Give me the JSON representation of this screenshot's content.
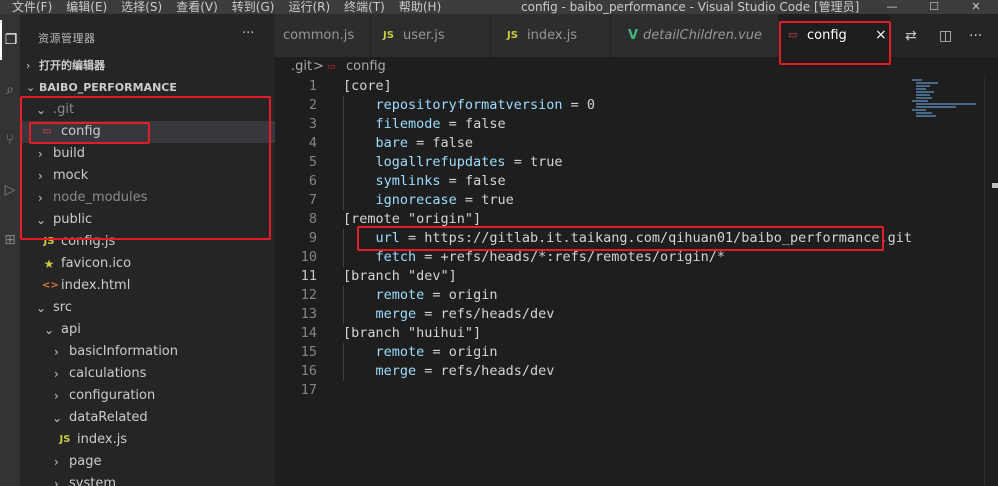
{
  "titlebar": {
    "menu": [
      "文件(F)",
      "编辑(E)",
      "选择(S)",
      "查看(V)",
      "转到(G)",
      "运行(R)",
      "终端(T)",
      "帮助(H)"
    ],
    "window_title": "config - baibo_performance - Visual Studio Code [管理员]"
  },
  "sidebar": {
    "title": "资源管理器",
    "more": "···",
    "open_editors_label": "打开的编辑器",
    "project_label": "BAIBO_PERFORMANCE",
    "tree": [
      {
        "label": ".git",
        "kind": "folder",
        "expanded": true,
        "dim": true
      },
      {
        "label": "config",
        "kind": "file",
        "icon": "config-file-icon",
        "selected": true
      },
      {
        "label": "build",
        "kind": "folder",
        "expanded": false
      },
      {
        "label": "mock",
        "kind": "folder",
        "expanded": false
      },
      {
        "label": "node_modules",
        "kind": "folder",
        "expanded": false,
        "dim": true
      },
      {
        "label": "public",
        "kind": "folder",
        "expanded": true
      },
      {
        "label": "config.js",
        "kind": "file",
        "icon": "js-file-icon"
      },
      {
        "label": "favicon.ico",
        "kind": "file",
        "icon": "star-icon"
      },
      {
        "label": "index.html",
        "kind": "file",
        "icon": "html-file-icon"
      },
      {
        "label": "src",
        "kind": "folder",
        "expanded": true
      },
      {
        "label": "api",
        "kind": "folder",
        "expanded": true
      },
      {
        "label": "basicInformation",
        "kind": "folder",
        "expanded": false
      },
      {
        "label": "calculations",
        "kind": "folder",
        "expanded": false
      },
      {
        "label": "configuration",
        "kind": "folder",
        "expanded": false
      },
      {
        "label": "dataRelated",
        "kind": "folder",
        "expanded": true
      },
      {
        "label": "index.js",
        "kind": "file",
        "icon": "js-file-icon"
      },
      {
        "label": "page",
        "kind": "folder",
        "expanded": false
      },
      {
        "label": "system",
        "kind": "folder",
        "expanded": false
      }
    ]
  },
  "tabs": [
    {
      "label": "common.js",
      "icon": ""
    },
    {
      "label": "user.js",
      "icon": "JS"
    },
    {
      "label": "index.js",
      "icon": "JS"
    },
    {
      "label": "detailChildren.vue",
      "icon": "V"
    },
    {
      "label": "config",
      "icon": "config",
      "active": true,
      "close": "×"
    }
  ],
  "breadcrumb": [
    ".git",
    ">",
    "config"
  ],
  "editor": {
    "current_line": 11,
    "lines": [
      {
        "n": "1",
        "text": "[core]"
      },
      {
        "n": "2",
        "key": "repositoryformatversion",
        "value": "0"
      },
      {
        "n": "3",
        "key": "filemode",
        "value": "false"
      },
      {
        "n": "4",
        "key": "bare",
        "value": "false"
      },
      {
        "n": "5",
        "key": "logallrefupdates",
        "value": "true"
      },
      {
        "n": "6",
        "key": "symlinks",
        "value": "false"
      },
      {
        "n": "7",
        "key": "ignorecase",
        "value": "true"
      },
      {
        "n": "8",
        "text": "[remote \"origin\"]"
      },
      {
        "n": "9",
        "key": "url",
        "value": "https://gitlab.it.taikang.com/qihuan01/baibo_performance.git"
      },
      {
        "n": "10",
        "key": "fetch",
        "value": "+refs/heads/*:refs/remotes/origin/*"
      },
      {
        "n": "11",
        "text": "[branch \"dev\"]"
      },
      {
        "n": "12",
        "key": "remote",
        "value": "origin"
      },
      {
        "n": "13",
        "key": "merge",
        "value": "refs/heads/dev"
      },
      {
        "n": "14",
        "text": "[branch \"huihui\"]"
      },
      {
        "n": "15",
        "key": "remote",
        "value": "origin"
      },
      {
        "n": "16",
        "key": "merge",
        "value": "refs/heads/dev"
      },
      {
        "n": "17",
        "text": ""
      }
    ]
  },
  "colors": {
    "highlight_box": "#e51c23",
    "key": "#9cdcfe",
    "text": "#d4d4d4",
    "line_number": "#858585"
  }
}
